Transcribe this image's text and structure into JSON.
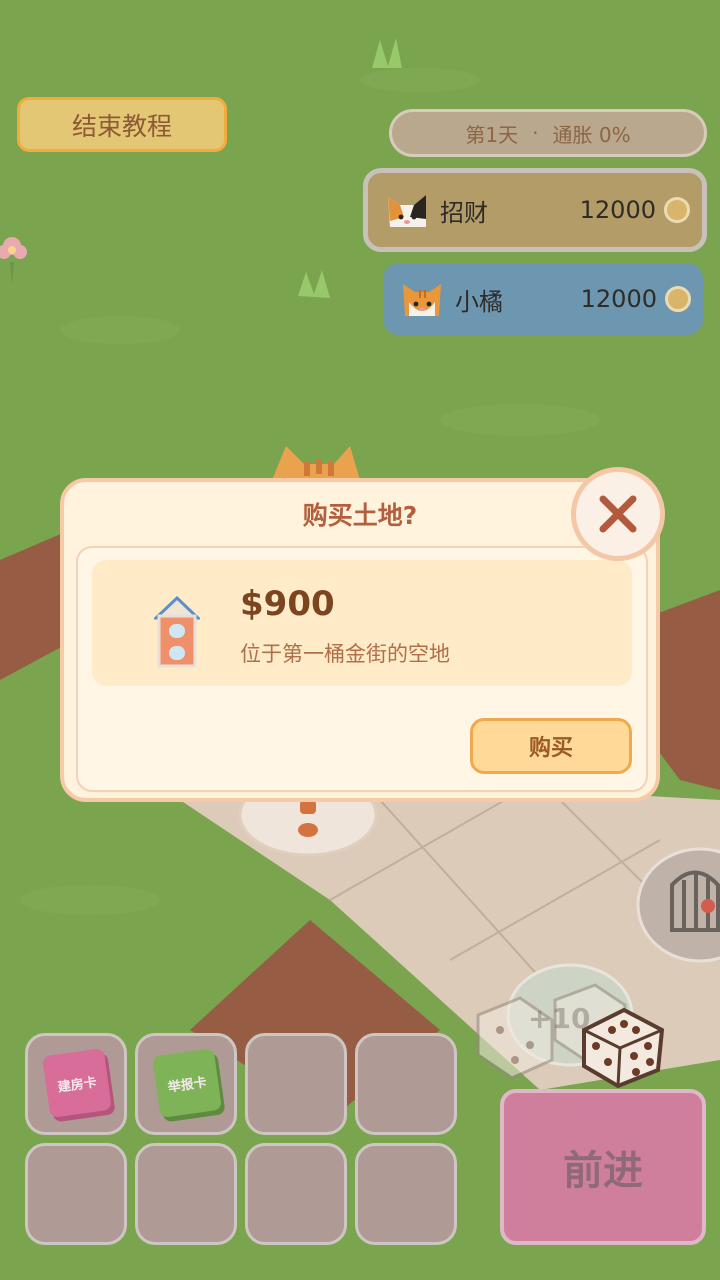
{
  "top": {
    "end_tutorial_label": "结束教程",
    "day_label": "第1天",
    "separator": "·",
    "inflation_label": "通胀 0%"
  },
  "players": [
    {
      "name": "招财",
      "money": "12000",
      "color": "#b39c68",
      "icon": "calico-cat-icon"
    },
    {
      "name": "小橘",
      "money": "12000",
      "color": "#6d96b0",
      "icon": "orange-cat-icon"
    }
  ],
  "dialog": {
    "title": "购买土地?",
    "price": "$900",
    "description": "位于第一桶金街的空地",
    "buy_label": "购买",
    "close_icon": "close-icon"
  },
  "cards": {
    "build_card_label": "建房卡",
    "report_card_label": "举报卡"
  },
  "board": {
    "dice_bonus_label": "+10"
  },
  "advance_label": "前进",
  "colors": {
    "grass": "#6b9a3a",
    "dialog_bg": "#fff3dd",
    "dialog_border": "#f6c9a9",
    "title_text": "#b35f3e",
    "buy_button": "#ffd998",
    "advance_button": "#cf7f9b"
  }
}
